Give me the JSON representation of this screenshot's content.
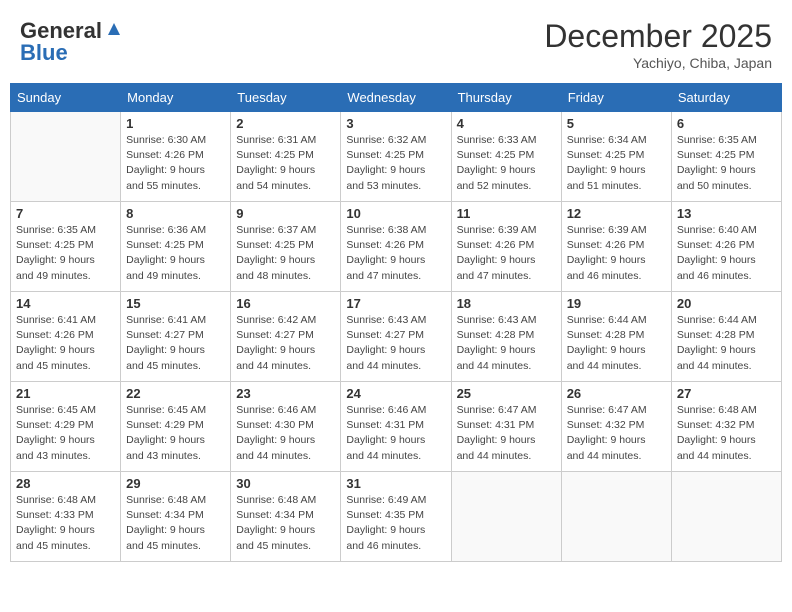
{
  "header": {
    "logo_general": "General",
    "logo_blue": "Blue",
    "month_title": "December 2025",
    "location": "Yachiyo, Chiba, Japan"
  },
  "days_of_week": [
    "Sunday",
    "Monday",
    "Tuesday",
    "Wednesday",
    "Thursday",
    "Friday",
    "Saturday"
  ],
  "weeks": [
    [
      {
        "day": "",
        "info": ""
      },
      {
        "day": "1",
        "info": "Sunrise: 6:30 AM\nSunset: 4:26 PM\nDaylight: 9 hours\nand 55 minutes."
      },
      {
        "day": "2",
        "info": "Sunrise: 6:31 AM\nSunset: 4:25 PM\nDaylight: 9 hours\nand 54 minutes."
      },
      {
        "day": "3",
        "info": "Sunrise: 6:32 AM\nSunset: 4:25 PM\nDaylight: 9 hours\nand 53 minutes."
      },
      {
        "day": "4",
        "info": "Sunrise: 6:33 AM\nSunset: 4:25 PM\nDaylight: 9 hours\nand 52 minutes."
      },
      {
        "day": "5",
        "info": "Sunrise: 6:34 AM\nSunset: 4:25 PM\nDaylight: 9 hours\nand 51 minutes."
      },
      {
        "day": "6",
        "info": "Sunrise: 6:35 AM\nSunset: 4:25 PM\nDaylight: 9 hours\nand 50 minutes."
      }
    ],
    [
      {
        "day": "7",
        "info": "Sunrise: 6:35 AM\nSunset: 4:25 PM\nDaylight: 9 hours\nand 49 minutes."
      },
      {
        "day": "8",
        "info": "Sunrise: 6:36 AM\nSunset: 4:25 PM\nDaylight: 9 hours\nand 49 minutes."
      },
      {
        "day": "9",
        "info": "Sunrise: 6:37 AM\nSunset: 4:25 PM\nDaylight: 9 hours\nand 48 minutes."
      },
      {
        "day": "10",
        "info": "Sunrise: 6:38 AM\nSunset: 4:26 PM\nDaylight: 9 hours\nand 47 minutes."
      },
      {
        "day": "11",
        "info": "Sunrise: 6:39 AM\nSunset: 4:26 PM\nDaylight: 9 hours\nand 47 minutes."
      },
      {
        "day": "12",
        "info": "Sunrise: 6:39 AM\nSunset: 4:26 PM\nDaylight: 9 hours\nand 46 minutes."
      },
      {
        "day": "13",
        "info": "Sunrise: 6:40 AM\nSunset: 4:26 PM\nDaylight: 9 hours\nand 46 minutes."
      }
    ],
    [
      {
        "day": "14",
        "info": "Sunrise: 6:41 AM\nSunset: 4:26 PM\nDaylight: 9 hours\nand 45 minutes."
      },
      {
        "day": "15",
        "info": "Sunrise: 6:41 AM\nSunset: 4:27 PM\nDaylight: 9 hours\nand 45 minutes."
      },
      {
        "day": "16",
        "info": "Sunrise: 6:42 AM\nSunset: 4:27 PM\nDaylight: 9 hours\nand 44 minutes."
      },
      {
        "day": "17",
        "info": "Sunrise: 6:43 AM\nSunset: 4:27 PM\nDaylight: 9 hours\nand 44 minutes."
      },
      {
        "day": "18",
        "info": "Sunrise: 6:43 AM\nSunset: 4:28 PM\nDaylight: 9 hours\nand 44 minutes."
      },
      {
        "day": "19",
        "info": "Sunrise: 6:44 AM\nSunset: 4:28 PM\nDaylight: 9 hours\nand 44 minutes."
      },
      {
        "day": "20",
        "info": "Sunrise: 6:44 AM\nSunset: 4:28 PM\nDaylight: 9 hours\nand 44 minutes."
      }
    ],
    [
      {
        "day": "21",
        "info": "Sunrise: 6:45 AM\nSunset: 4:29 PM\nDaylight: 9 hours\nand 43 minutes."
      },
      {
        "day": "22",
        "info": "Sunrise: 6:45 AM\nSunset: 4:29 PM\nDaylight: 9 hours\nand 43 minutes."
      },
      {
        "day": "23",
        "info": "Sunrise: 6:46 AM\nSunset: 4:30 PM\nDaylight: 9 hours\nand 44 minutes."
      },
      {
        "day": "24",
        "info": "Sunrise: 6:46 AM\nSunset: 4:31 PM\nDaylight: 9 hours\nand 44 minutes."
      },
      {
        "day": "25",
        "info": "Sunrise: 6:47 AM\nSunset: 4:31 PM\nDaylight: 9 hours\nand 44 minutes."
      },
      {
        "day": "26",
        "info": "Sunrise: 6:47 AM\nSunset: 4:32 PM\nDaylight: 9 hours\nand 44 minutes."
      },
      {
        "day": "27",
        "info": "Sunrise: 6:48 AM\nSunset: 4:32 PM\nDaylight: 9 hours\nand 44 minutes."
      }
    ],
    [
      {
        "day": "28",
        "info": "Sunrise: 6:48 AM\nSunset: 4:33 PM\nDaylight: 9 hours\nand 45 minutes."
      },
      {
        "day": "29",
        "info": "Sunrise: 6:48 AM\nSunset: 4:34 PM\nDaylight: 9 hours\nand 45 minutes."
      },
      {
        "day": "30",
        "info": "Sunrise: 6:48 AM\nSunset: 4:34 PM\nDaylight: 9 hours\nand 45 minutes."
      },
      {
        "day": "31",
        "info": "Sunrise: 6:49 AM\nSunset: 4:35 PM\nDaylight: 9 hours\nand 46 minutes."
      },
      {
        "day": "",
        "info": ""
      },
      {
        "day": "",
        "info": ""
      },
      {
        "day": "",
        "info": ""
      }
    ]
  ]
}
